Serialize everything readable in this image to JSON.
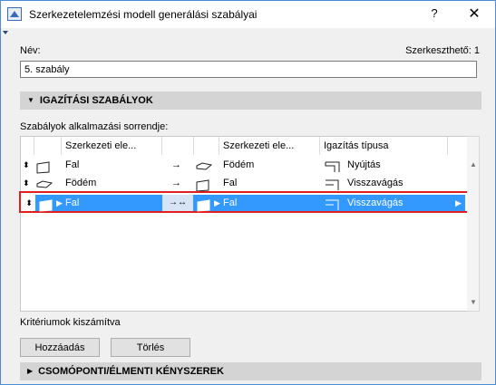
{
  "window": {
    "title": "Szerkezetelemzési modell generálási szabályai",
    "help_glyph": "?",
    "close_glyph": "✕"
  },
  "name_label": "Név:",
  "editable_label": "Szerkeszthető: 1",
  "name_value": "5. szabály",
  "section_alignment": "IGAZÍTÁSI SZABÁLYOK",
  "order_label": "Szabályok alkalmazási sorrendje:",
  "table": {
    "columns": [
      "Szerkezeti ele...",
      "Szerkezeti ele...",
      "Igazítás típusa"
    ],
    "rows": [
      {
        "from": "Fal",
        "to": "Födém",
        "type": "Nyújtás",
        "from_icon": "wall-icon",
        "to_icon": "slab-icon",
        "selected": false
      },
      {
        "from": "Födém",
        "to": "Fal",
        "type": "Visszavágás",
        "from_icon": "slab-icon",
        "to_icon": "wall-icon",
        "selected": false
      },
      {
        "from": "Fal",
        "to": "Fal",
        "type": "Visszavágás",
        "from_icon": "wall-icon",
        "to_icon": "wall-icon",
        "selected": true
      }
    ]
  },
  "criteria_label": "Kritériumok kiszámítva",
  "buttons": {
    "add": "Hozzáadás",
    "delete": "Törlés"
  },
  "section_constraints": "CSOMÓPONTI/ÉLMENTI KÉNYSZEREK",
  "colors": {
    "selection": "#3399ff",
    "highlight_border": "#e02020",
    "section_bg": "#d4d4d4"
  }
}
